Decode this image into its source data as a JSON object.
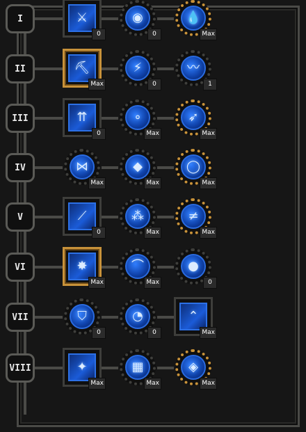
{
  "rows": [
    {
      "label": "I",
      "skills": [
        {
          "shape": "square",
          "icon": "sword-icon",
          "level": "0"
        },
        {
          "shape": "round",
          "icon": "orb-icon",
          "level": "0"
        },
        {
          "shape": "round",
          "gold": true,
          "icon": "water-drop-icon",
          "level": "Max"
        }
      ]
    },
    {
      "label": "II",
      "skills": [
        {
          "shape": "square",
          "gold": true,
          "icon": "pickaxe-icon",
          "level": "Max"
        },
        {
          "shape": "round",
          "icon": "speed-boot-icon",
          "level": "0"
        },
        {
          "shape": "round",
          "icon": "wave-icon",
          "level": "1"
        }
      ]
    },
    {
      "label": "III",
      "skills": [
        {
          "shape": "square",
          "icon": "arrows-up-icon",
          "level": "0"
        },
        {
          "shape": "round",
          "icon": "bubbles-icon",
          "level": "Max"
        },
        {
          "shape": "round",
          "gold": true,
          "icon": "bow-icon",
          "level": "Max"
        }
      ]
    },
    {
      "label": "IV",
      "skills": [
        {
          "shape": "round",
          "icon": "bow-tie-icon",
          "level": "Max"
        },
        {
          "shape": "round",
          "icon": "droplet-icon",
          "level": "Max"
        },
        {
          "shape": "round",
          "gold": true,
          "icon": "ring-icon",
          "level": "Max"
        }
      ]
    },
    {
      "label": "V",
      "skills": [
        {
          "shape": "square",
          "icon": "slash-icon",
          "level": "0"
        },
        {
          "shape": "round",
          "icon": "bubble-cluster-icon",
          "level": "Max"
        },
        {
          "shape": "round",
          "gold": true,
          "icon": "split-icon",
          "level": "Max"
        }
      ]
    },
    {
      "label": "VI",
      "skills": [
        {
          "shape": "square",
          "gold": true,
          "icon": "burst-icon",
          "level": "Max"
        },
        {
          "shape": "round",
          "icon": "arc-icon",
          "level": "Max"
        },
        {
          "shape": "round",
          "icon": "gems-icon",
          "level": "0"
        }
      ]
    },
    {
      "label": "VII",
      "skills": [
        {
          "shape": "round",
          "icon": "shield-icon",
          "level": "0"
        },
        {
          "shape": "round",
          "icon": "clock-orb-icon",
          "level": "0"
        },
        {
          "shape": "square",
          "icon": "chevron-up-icon",
          "level": "Max"
        }
      ]
    },
    {
      "label": "VIII",
      "skills": [
        {
          "shape": "square",
          "icon": "strike-icon",
          "level": "Max"
        },
        {
          "shape": "round",
          "icon": "cubes-icon",
          "level": "Max"
        },
        {
          "shape": "round",
          "gold": true,
          "icon": "crystals-icon",
          "level": "Max"
        }
      ]
    }
  ],
  "colors": {
    "gold": "#c8923a",
    "blue": "#1b5bd8",
    "frame": "#4a4a47"
  }
}
